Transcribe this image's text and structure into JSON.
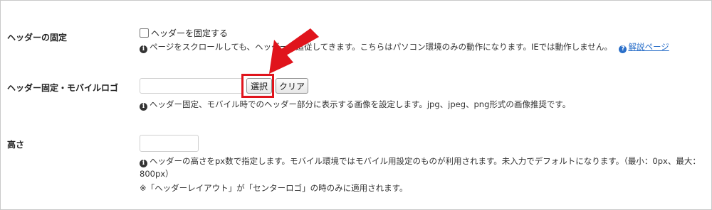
{
  "header_fixed": {
    "label": "ヘッダーの固定",
    "checkbox_label": "ヘッダーを固定する",
    "desc": "ページをスクロールしても、ヘッダーが追従してきます。こちらはパソコン環境のみの動作になります。IEでは動作しません。",
    "help_link": "解説ページ"
  },
  "header_logo": {
    "label": "ヘッダー固定・モバイルロゴ",
    "input_value": "",
    "select_button": "選択",
    "clear_button": "クリア",
    "desc": "ヘッダー固定、モバイル時でのヘッダー部分に表示する画像を設定します。jpg、jpeg、png形式の画像推奨です。"
  },
  "height": {
    "label": "高さ",
    "input_value": "",
    "desc_line1": "ヘッダーの高さをpx数で指定します。モバイル環境ではモバイル用設定のものが利用されます。未入力でデフォルトになります。（最小：0px、最大：",
    "desc_line2": "800px）",
    "note": "※「ヘッダーレイアウト」が「センターロゴ」の時のみに適用されます。"
  },
  "colors": {
    "annotation_red": "#e0141c",
    "link_blue": "#2a6fc9"
  },
  "icons": {
    "info": "info-circle-icon",
    "help": "question-circle-icon",
    "arrow": "red-arrow-annotation"
  }
}
